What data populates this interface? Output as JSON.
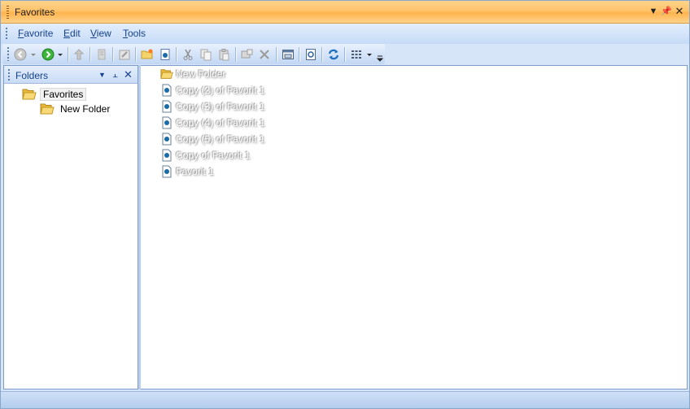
{
  "window": {
    "title": "Favorites"
  },
  "menubar": {
    "items": [
      {
        "label": "Favorite",
        "mnemonic": "F",
        "rest": "avorite"
      },
      {
        "label": "Edit",
        "mnemonic": "E",
        "rest": "dit"
      },
      {
        "label": "View",
        "mnemonic": "V",
        "rest": "iew"
      },
      {
        "label": "Tools",
        "mnemonic": "T",
        "rest": "ools"
      }
    ]
  },
  "toolbar": {
    "buttons": [
      "back-icon",
      "forward-icon",
      "up-folder-icon",
      "disabled-icon",
      "properties-icon",
      "new-folder-icon",
      "new-favorite-icon",
      "cut-icon",
      "copy-icon",
      "paste-icon",
      "move-icon",
      "delete-icon",
      "window-icon",
      "preview-icon",
      "refresh-icon",
      "view-grid-icon"
    ]
  },
  "folders_pane": {
    "title": "Folders",
    "tree": [
      {
        "label": "Favorites",
        "level": 0,
        "selected": true
      },
      {
        "label": "New Folder",
        "level": 1,
        "selected": false
      }
    ]
  },
  "main_list": {
    "items": [
      {
        "label": "New Folder",
        "type": "folder"
      },
      {
        "label": "Copy (2) of Favorit 1",
        "type": "favorite"
      },
      {
        "label": "Copy (3) of Favorit 1",
        "type": "favorite"
      },
      {
        "label": "Copy (4) of Favorit 1",
        "type": "favorite"
      },
      {
        "label": "Copy (5) of Favorit 1",
        "type": "favorite"
      },
      {
        "label": "Copy of Favorit 1",
        "type": "favorite"
      },
      {
        "label": "Favorit 1",
        "type": "favorite"
      }
    ]
  },
  "colors": {
    "title_bar": "#ffc36b",
    "menu_text": "#15428b",
    "pane_border": "#7d9ccc"
  }
}
